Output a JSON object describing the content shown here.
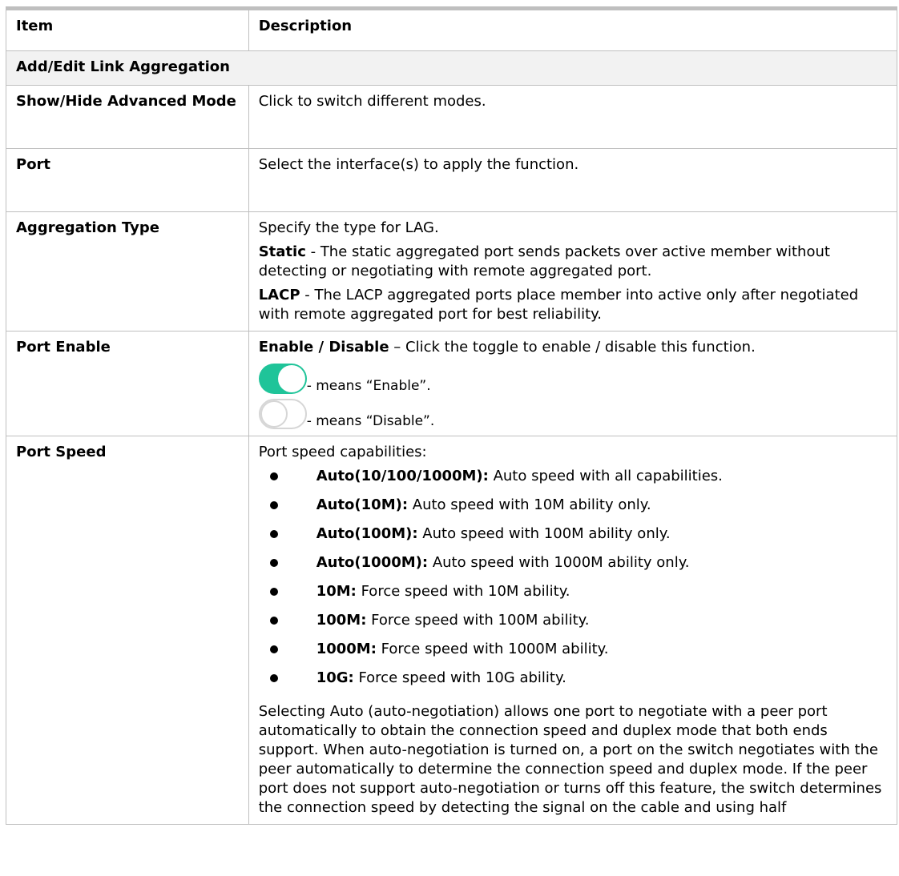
{
  "table": {
    "header": {
      "item": "Item",
      "description": "Description"
    },
    "section_title": "Add/Edit Link Aggregation",
    "rows": {
      "show_hide": {
        "item": "Show/Hide Advanced Mode",
        "description": "Click to switch different modes."
      },
      "port": {
        "item": "Port",
        "description": "Select the interface(s) to apply the function."
      },
      "aggregation_type": {
        "item": "Aggregation Type",
        "intro": "Specify the type for LAG.",
        "static_label": "Static",
        "static_text": " - The static aggregated port sends packets over active member without detecting or negotiating with remote aggregated port.",
        "lacp_label": "LACP",
        "lacp_text": " - The LACP aggregated ports place member into active only after negotiated with remote aggregated port for best reliability."
      },
      "port_enable": {
        "item": "Port Enable",
        "label": "Enable / Disable",
        "text": " – Click the toggle to enable / disable this function.",
        "enable_caption": "- means “Enable”.",
        "disable_caption": "- means “Disable”."
      },
      "port_speed": {
        "item": "Port Speed",
        "intro": "Port speed capabilities:",
        "options": [
          {
            "label": "Auto(10/100/1000M):",
            "text": " Auto speed with all capabilities."
          },
          {
            "label": "Auto(10M):",
            "text": " Auto speed with 10M ability only."
          },
          {
            "label": "Auto(100M):",
            "text": " Auto speed with 100M ability only."
          },
          {
            "label": "Auto(1000M):",
            "text": " Auto speed with 1000M ability only."
          },
          {
            "label": "10M:",
            "text": " Force speed with 10M ability."
          },
          {
            "label": "100M:",
            "text": " Force speed with 100M ability."
          },
          {
            "label": "1000M:",
            "text": " Force speed with 1000M ability."
          },
          {
            "label": "10G:",
            "text": " Force speed with 10G ability."
          }
        ],
        "note": "Selecting Auto (auto-negotiation) allows one port to negotiate with a peer port automatically to obtain the connection speed and duplex mode that both ends support. When auto-negotiation is turned on, a port on the switch negotiates with the peer automatically to determine the connection speed and duplex mode. If the peer port does not support auto-negotiation or turns off this feature, the switch determines the connection speed by detecting the signal on the cable and using half"
      }
    }
  },
  "colors": {
    "toggle_on": "#1fc499",
    "toggle_off_border": "#d6d6d6",
    "table_border": "#bfbfbf"
  },
  "toggle_states": {
    "enable_example": "on",
    "disable_example": "off"
  }
}
